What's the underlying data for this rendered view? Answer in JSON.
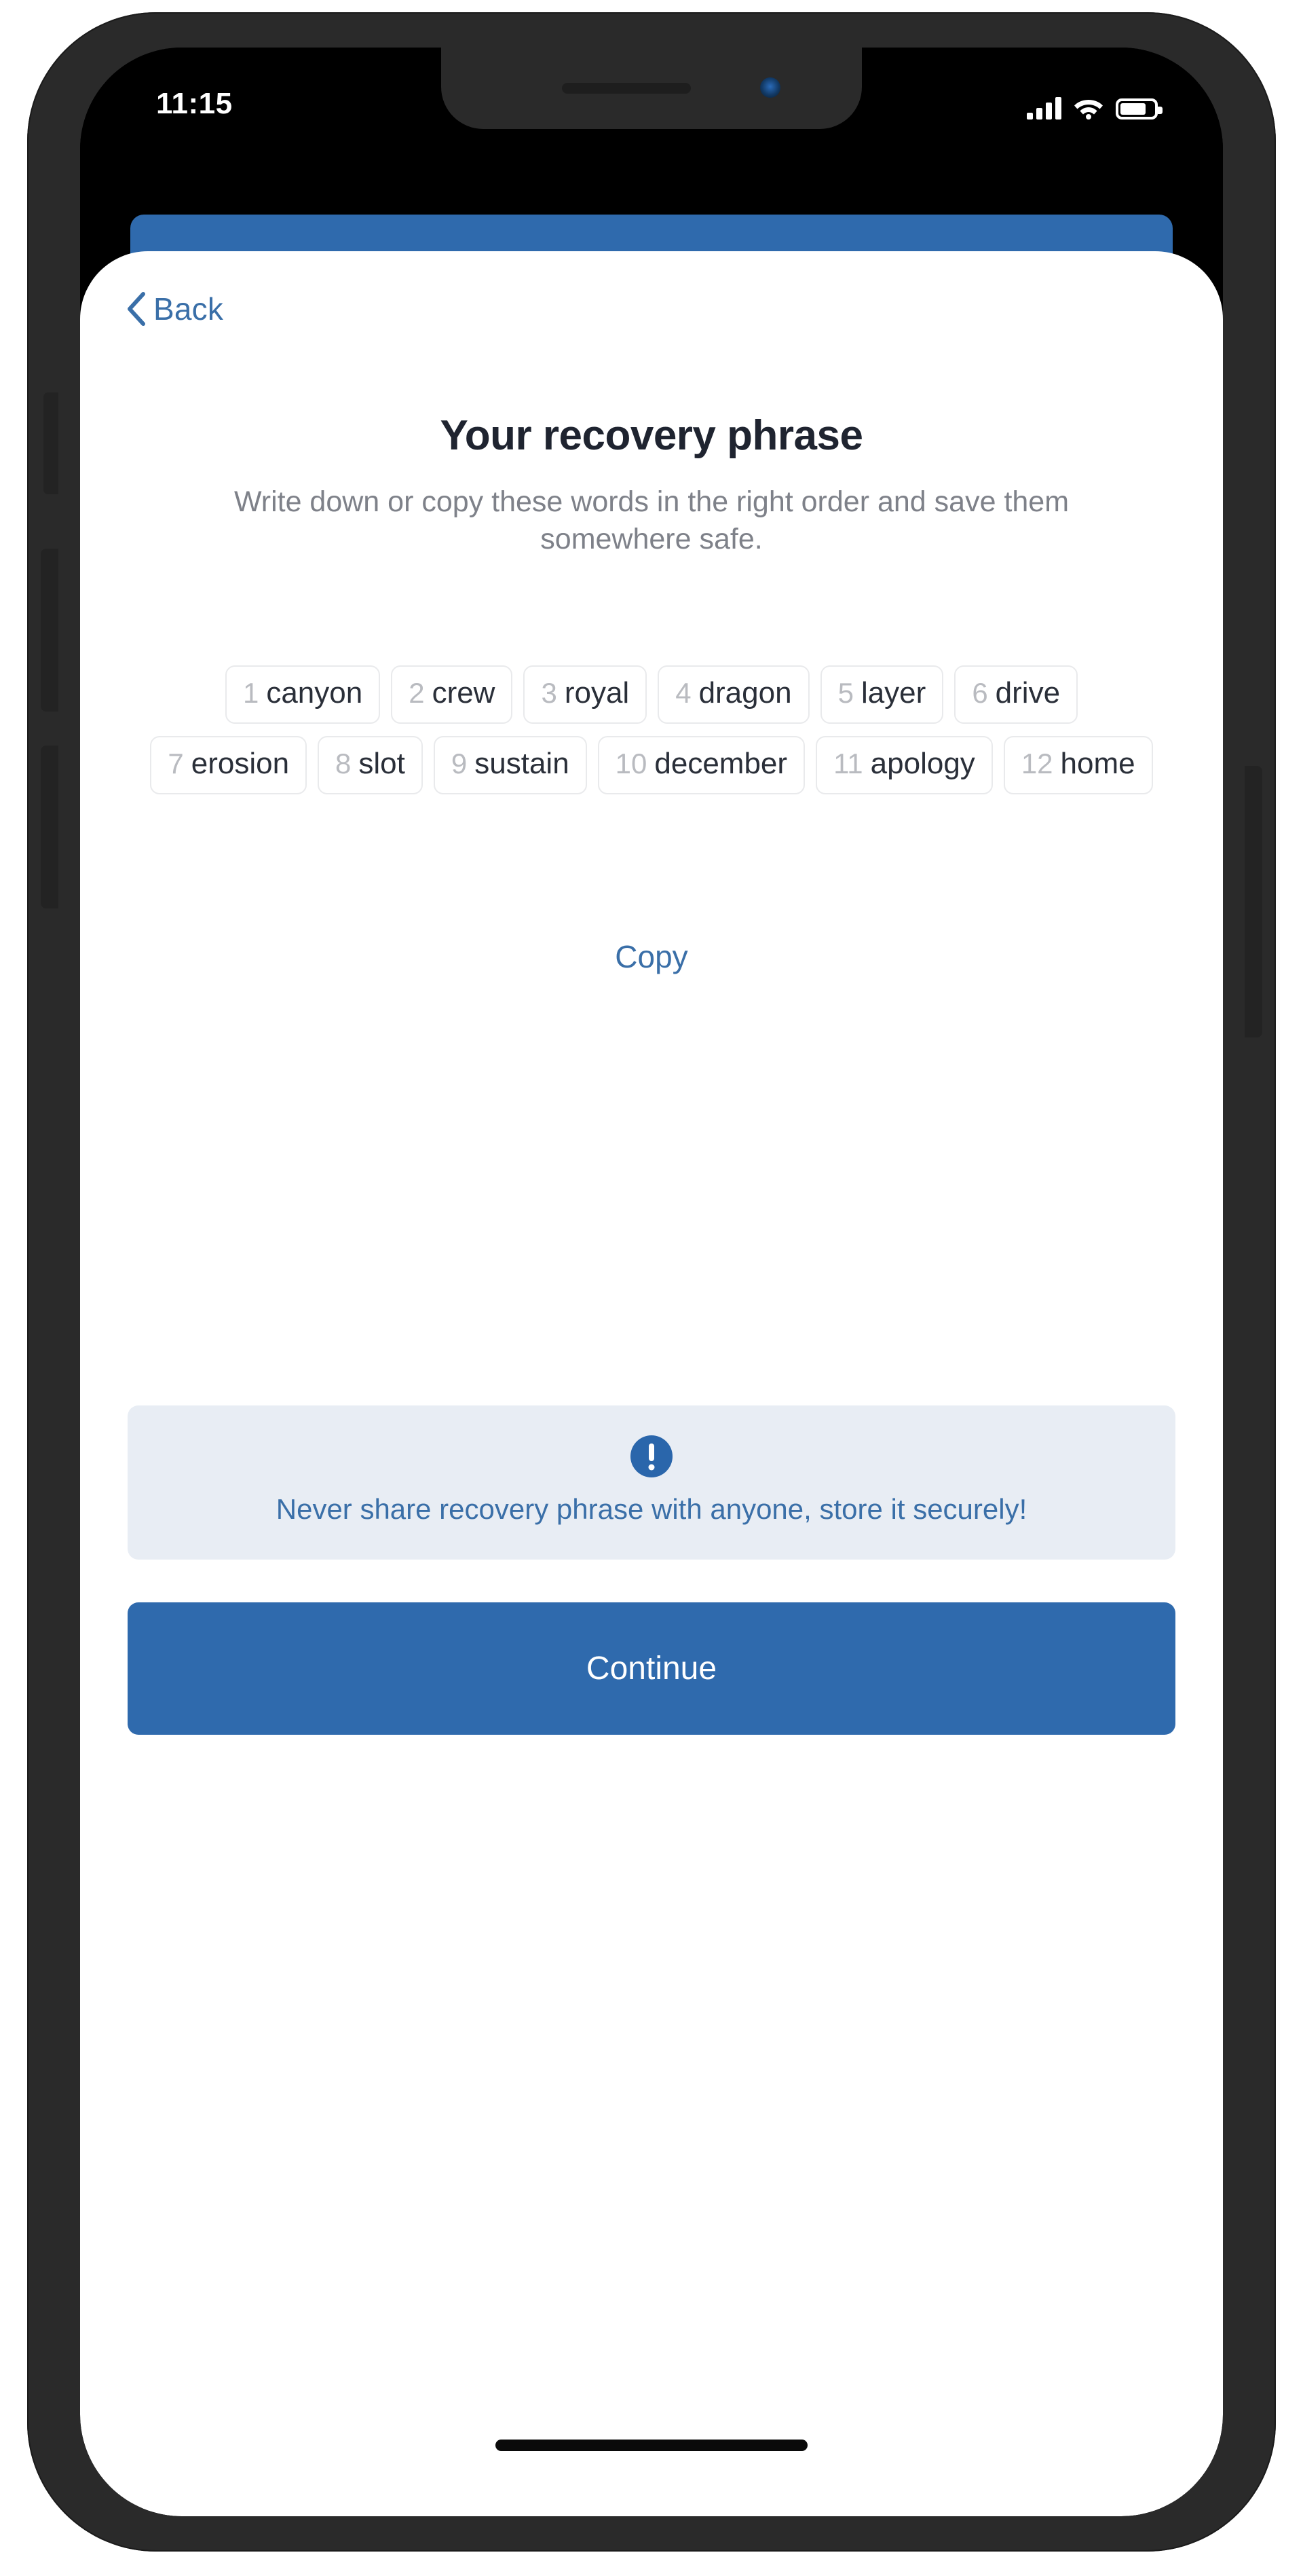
{
  "status_bar": {
    "time": "11:15",
    "signal_icon": "cellular-signal-icon",
    "wifi_icon": "wifi-icon",
    "battery_icon": "battery-icon"
  },
  "nav": {
    "back_label": "Back",
    "back_icon": "chevron-left-icon"
  },
  "screen": {
    "title": "Your recovery phrase",
    "subtitle": "Write down or copy these words in the right order and save them somewhere safe."
  },
  "recovery_phrase": {
    "words": [
      {
        "index": "1",
        "word": "canyon"
      },
      {
        "index": "2",
        "word": "crew"
      },
      {
        "index": "3",
        "word": "royal"
      },
      {
        "index": "4",
        "word": "dragon"
      },
      {
        "index": "5",
        "word": "layer"
      },
      {
        "index": "6",
        "word": "drive"
      },
      {
        "index": "7",
        "word": "erosion"
      },
      {
        "index": "8",
        "word": "slot"
      },
      {
        "index": "9",
        "word": "sustain"
      },
      {
        "index": "10",
        "word": "december"
      },
      {
        "index": "11",
        "word": "apology"
      },
      {
        "index": "12",
        "word": "home"
      }
    ],
    "copy_label": "Copy"
  },
  "alert": {
    "icon": "exclamation-circle-icon",
    "message": "Never share recovery phrase with anyone, store it securely!"
  },
  "cta": {
    "label": "Continue"
  },
  "colors": {
    "brand_blue": "#2f6aad",
    "link_blue": "#3a6fa8",
    "alert_bg": "#e8edf4",
    "chip_border": "#e9eaec",
    "chip_number": "#b9bbc0",
    "chip_word": "#2a2f39",
    "title": "#1f2430",
    "subtitle": "#7e8189"
  }
}
